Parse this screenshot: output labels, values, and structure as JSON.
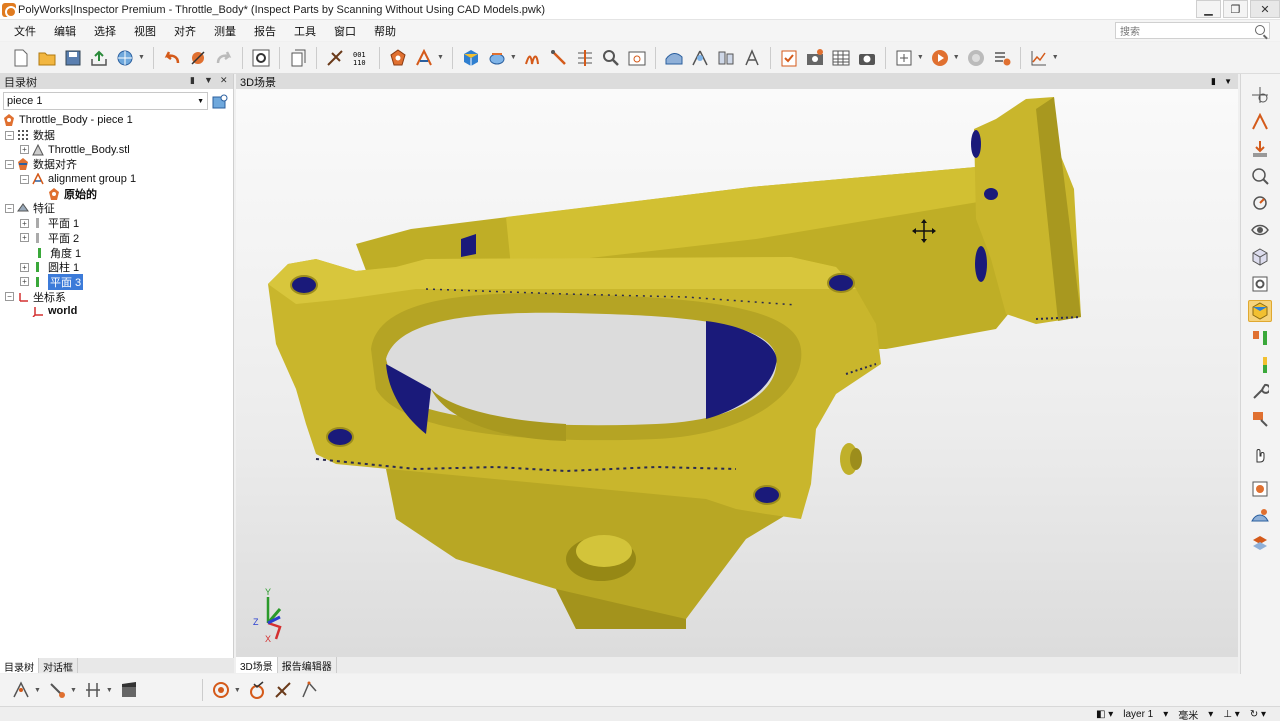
{
  "window": {
    "title": "PolyWorks|Inspector Premium - Throttle_Body* (Inspect Parts by Scanning Without Using CAD Models.pwk)",
    "buttons": [
      "▁",
      "❐",
      "✕"
    ]
  },
  "menu": [
    "文件",
    "编辑",
    "选择",
    "视图",
    "对齐",
    "测量",
    "报告",
    "工具",
    "窗口",
    "帮助"
  ],
  "search": {
    "placeholder": "搜索"
  },
  "tree_panel": {
    "title": "目录树",
    "piece_select": "piece 1",
    "items": [
      {
        "label": "Throttle_Body - piece 1"
      },
      {
        "label": "数据"
      },
      {
        "label": "Throttle_Body.stl"
      },
      {
        "label": "数据对齐"
      },
      {
        "label": "alignment group 1"
      },
      {
        "label": "原始的"
      },
      {
        "label": "特征"
      },
      {
        "label": "平面 1"
      },
      {
        "label": "平面 2"
      },
      {
        "label": "角度 1"
      },
      {
        "label": "圆柱 1"
      },
      {
        "label": "平面 3"
      },
      {
        "label": "坐标系"
      },
      {
        "label": "world"
      }
    ]
  },
  "left_tabs": [
    "目录树",
    "对话框"
  ],
  "scene": {
    "title": "3D场景",
    "tabs": [
      "3D场景",
      "报告编辑器"
    ],
    "axes": {
      "y": "Y",
      "z": "Z",
      "x": "X"
    },
    "colors": {
      "part": "#c8b428",
      "holes": "#1a1a7a"
    }
  },
  "status": {
    "layer": "layer 1",
    "unit": "毫米"
  }
}
